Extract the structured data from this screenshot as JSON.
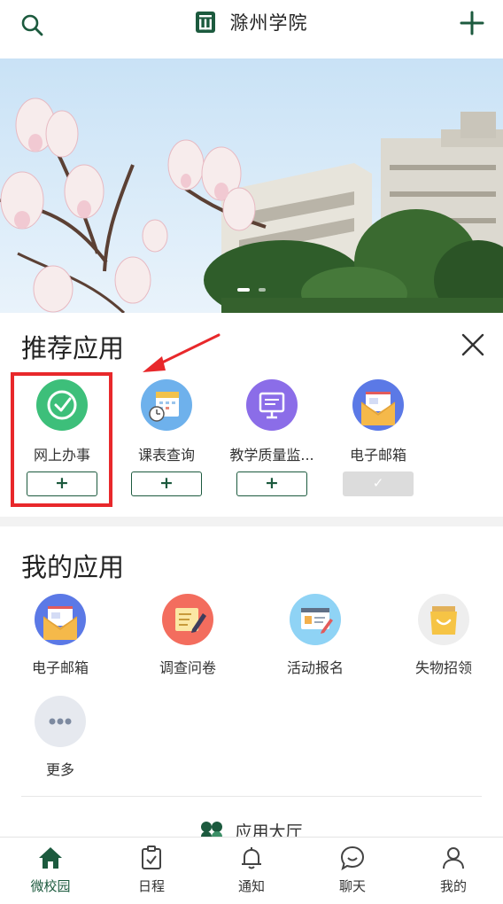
{
  "header": {
    "title": "滁州学院",
    "search_icon": "search-icon",
    "add_icon": "plus-icon",
    "logo_icon": "school-logo-icon"
  },
  "banner": {
    "description_icon": "campus-magnolia-photo",
    "slides_total": 2,
    "slide_active": 1
  },
  "recommend": {
    "title": "推荐应用",
    "close_icon": "close-icon",
    "items": [
      {
        "label": "网上办事",
        "icon": "online-service-icon",
        "color": "#3dbf7a",
        "added": false
      },
      {
        "label": "课表查询",
        "icon": "timetable-icon",
        "color": "#6eb1ec",
        "added": false
      },
      {
        "label": "教学质量监...",
        "icon": "teaching-quality-icon",
        "color": "#8b6de8",
        "added": false
      },
      {
        "label": "电子邮箱",
        "icon": "email-icon",
        "color": "#5b79e6",
        "added": true
      }
    ]
  },
  "my_apps": {
    "title": "我的应用",
    "items": [
      {
        "label": "电子邮箱",
        "icon": "email-icon"
      },
      {
        "label": "调查问卷",
        "icon": "survey-icon"
      },
      {
        "label": "活动报名",
        "icon": "event-signup-icon"
      },
      {
        "label": "失物招领",
        "icon": "lost-found-icon"
      },
      {
        "label": "更多",
        "icon": "more-icon"
      }
    ],
    "hall_label": "应用大厅"
  },
  "tabbar": {
    "items": [
      {
        "label": "微校园",
        "icon": "home-icon",
        "active": true
      },
      {
        "label": "日程",
        "icon": "schedule-icon",
        "active": false
      },
      {
        "label": "通知",
        "icon": "bell-icon",
        "active": false
      },
      {
        "label": "聊天",
        "icon": "chat-icon",
        "active": false
      },
      {
        "label": "我的",
        "icon": "profile-icon",
        "active": false
      }
    ]
  },
  "colors": {
    "brand_green": "#1c5a3e",
    "highlight_red": "#e8282b"
  }
}
